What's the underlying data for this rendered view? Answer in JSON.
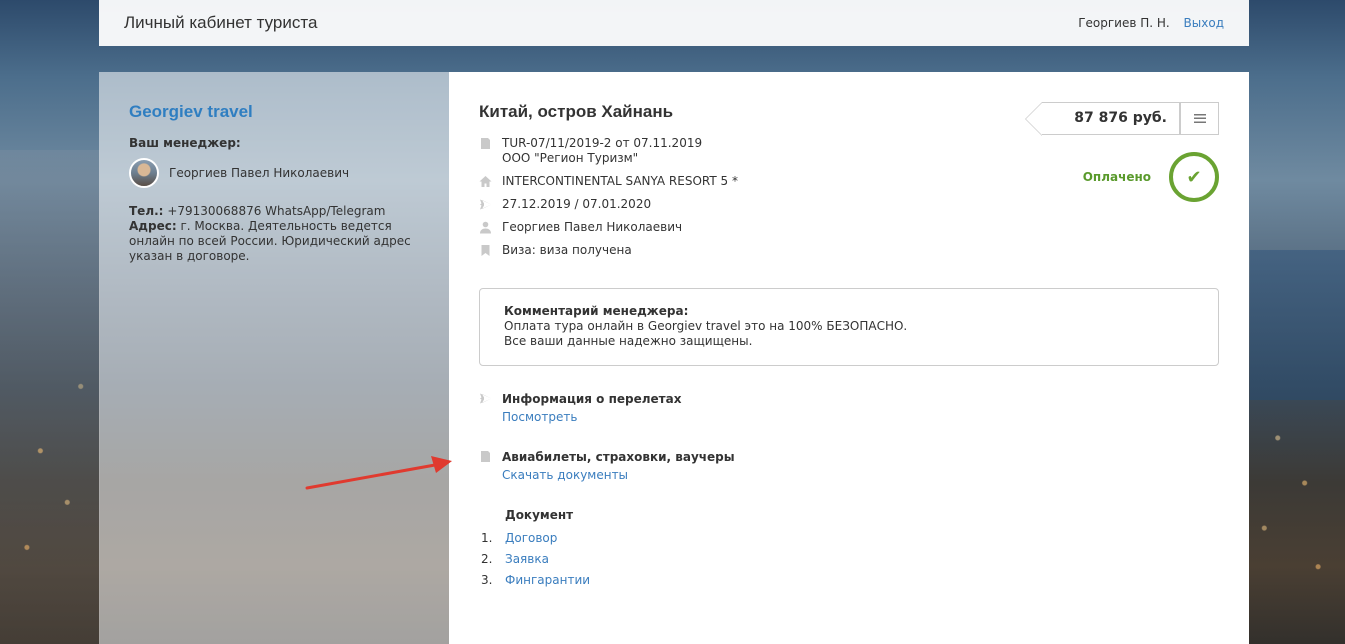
{
  "header": {
    "title": "Личный кабинет туриста",
    "user_name": "Георгиев П. Н.",
    "logout_label": "Выход"
  },
  "agency": {
    "name": "Georgiev travel",
    "manager_label": "Ваш менеджер:",
    "manager_name": "Георгиев Павел Николаевич",
    "phone_label": "Тел.:",
    "phone_value": "+79130068876 WhatsApp/Telegram",
    "address_label": "Адрес:",
    "address_value": "г. Москва. Деятельность ведется онлайн по всей России. Юридический адрес указан в договоре."
  },
  "tour": {
    "title": "Китай, остров Хайнань",
    "contract": "TUR-07/11/2019-2 от 07.11.2019",
    "operator": "ООО \"Регион Туризм\"",
    "hotel": "INTERCONTINENTAL SANYA RESORT 5 *",
    "dates": "27.12.2019 / 07.01.2020",
    "tourist": "Георгиев Павел Николаевич",
    "visa": "Виза: виза получена",
    "price": "87 876 руб.",
    "status": "Оплачено"
  },
  "comment": {
    "heading": "Комментарий менеджера:",
    "line1": "Оплата тура онлайн в Georgiev travel это на 100% БЕЗОПАСНО.",
    "line2": "Все ваши данные надежно защищены."
  },
  "flights": {
    "heading": "Информация о перелетах",
    "link": "Посмотреть"
  },
  "documents_section": {
    "heading": "Авиабилеты, страховки, ваучеры",
    "link": "Скачать документы"
  },
  "docs": {
    "heading": "Документ",
    "items": [
      {
        "num": "1.",
        "label": "Договор"
      },
      {
        "num": "2.",
        "label": "Заявка"
      },
      {
        "num": "3.",
        "label": "Фингарантии"
      }
    ]
  },
  "colors": {
    "link": "#3a7dbe",
    "brand": "#2f7ec1",
    "paid": "#6aa332",
    "arrow": "#e03a2f"
  },
  "icons": [
    "document-icon",
    "home-icon",
    "plane-icon",
    "person-icon",
    "bookmark-icon",
    "menu-icon",
    "check-icon"
  ]
}
